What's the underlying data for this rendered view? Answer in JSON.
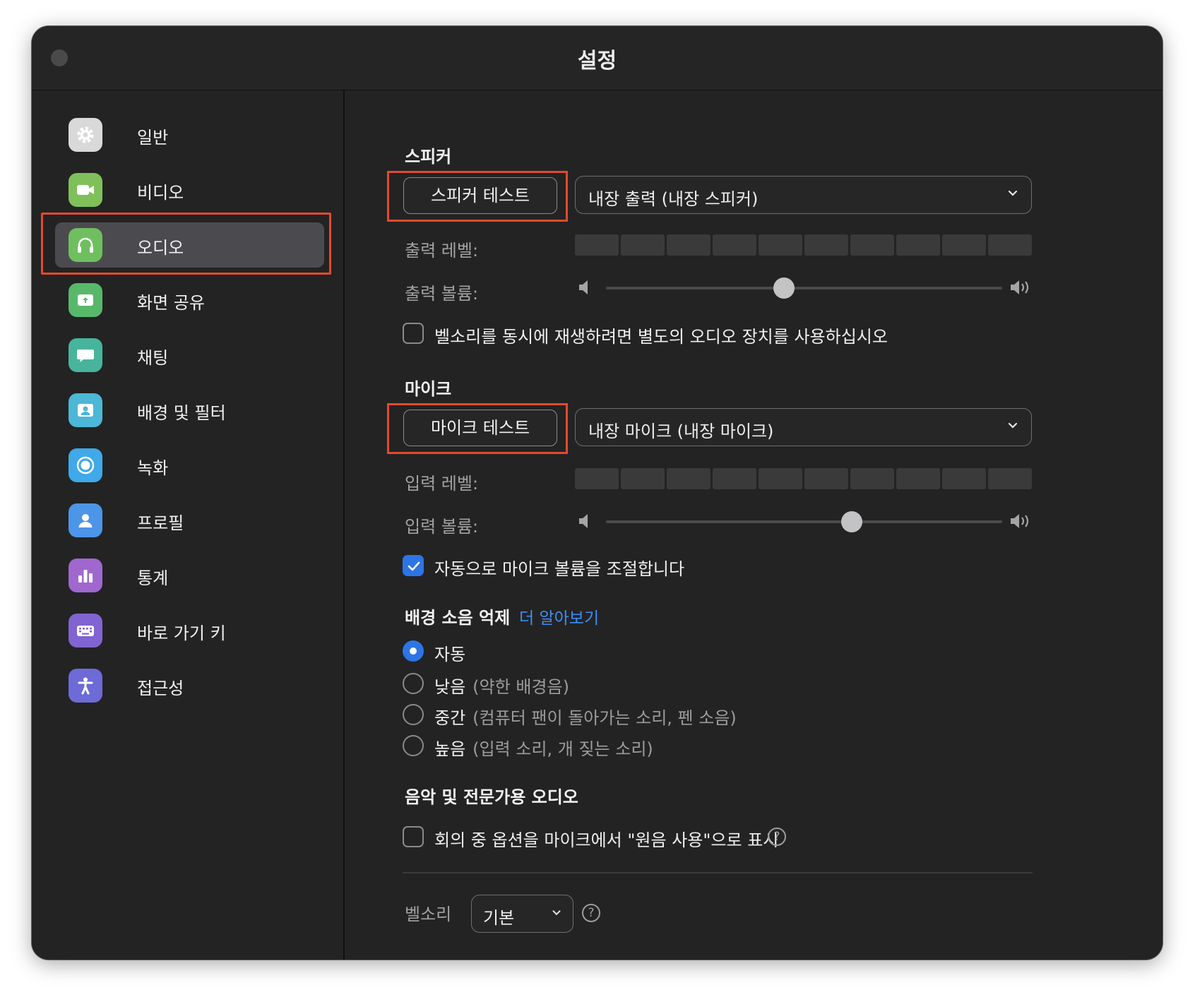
{
  "window": {
    "title": "설정"
  },
  "sidebar": {
    "items": [
      {
        "label": "일반",
        "icon": "gear-icon",
        "color": "#d9d9d9"
      },
      {
        "label": "비디오",
        "icon": "video-camera-icon",
        "color": "#7fc05a"
      },
      {
        "label": "오디오",
        "icon": "headphones-icon",
        "color": "#6fbf5f",
        "active": true
      },
      {
        "label": "화면 공유",
        "icon": "share-screen-icon",
        "color": "#57b86a"
      },
      {
        "label": "채팅",
        "icon": "chat-bubble-icon",
        "color": "#48b49b"
      },
      {
        "label": "배경 및 필터",
        "icon": "background-person-icon",
        "color": "#4cb7d6"
      },
      {
        "label": "녹화",
        "icon": "record-icon",
        "color": "#3fa9e9"
      },
      {
        "label": "프로필",
        "icon": "profile-icon",
        "color": "#4c95e8"
      },
      {
        "label": "통계",
        "icon": "bar-chart-icon",
        "color": "#a067cf"
      },
      {
        "label": "바로 가기 키",
        "icon": "keyboard-icon",
        "color": "#8163d2"
      },
      {
        "label": "접근성",
        "icon": "accessibility-icon",
        "color": "#6c6bd7"
      }
    ]
  },
  "speaker": {
    "title": "스피커",
    "test_button": "스피커 테스트",
    "device": "내장 출력 (내장 스피커)",
    "level_label": "출력 레벨:",
    "volume_label": "출력 볼륨:",
    "volume_value": 0.45,
    "ring_checkbox_label": "벨소리를 동시에 재생하려면 별도의 오디오 장치를 사용하십시오",
    "ring_checkbox_checked": false
  },
  "mic": {
    "title": "마이크",
    "test_button": "마이크 테스트",
    "device": "내장 마이크 (내장 마이크)",
    "level_label": "입력 레벨:",
    "volume_label": "입력 볼륨:",
    "volume_value": 0.62,
    "auto_adjust_label": "자동으로 마이크 볼륨을 조절합니다",
    "auto_adjust_checked": true
  },
  "noise": {
    "title": "배경 소음 억제",
    "learn_more": "더 알아보기",
    "options": [
      {
        "label": "자동",
        "hint": "",
        "selected": true
      },
      {
        "label": "낮음",
        "hint": "(약한 배경음)",
        "selected": false
      },
      {
        "label": "중간",
        "hint": "(컴퓨터 팬이 돌아가는 소리, 펜 소음)",
        "selected": false
      },
      {
        "label": "높음",
        "hint": "(입력 소리, 개 짖는 소리)",
        "selected": false
      }
    ]
  },
  "music": {
    "title": "음악 및 전문가용 오디오",
    "original_sound_label": "회의 중 옵션을 마이크에서 \"원음 사용\"으로 표시",
    "original_sound_checked": false,
    "help_icon": "?"
  },
  "ringtone": {
    "label": "벨소리",
    "value": "기본",
    "help_icon": "?"
  },
  "colors": {
    "accent": "#2d74e6",
    "link": "#3e8ef7",
    "highlight_box": "#e24a2e"
  }
}
